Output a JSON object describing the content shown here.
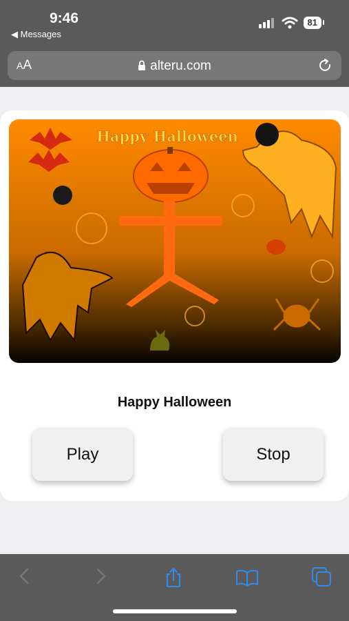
{
  "status": {
    "time": "9:46",
    "back_app": "◀ Messages",
    "battery": "81"
  },
  "browser": {
    "aa_small": "A",
    "aa_big": "A",
    "url": "alteru.com"
  },
  "card": {
    "poster_heading": "Happy Halloween",
    "title": "Happy Halloween",
    "play_label": "Play",
    "stop_label": "Stop"
  },
  "toolbar": {
    "items": [
      "back-icon",
      "forward-icon",
      "share-icon",
      "bookmarks-icon",
      "tabs-icon"
    ],
    "disabled_color": "#777777",
    "active_color": "#2f8bf0"
  }
}
